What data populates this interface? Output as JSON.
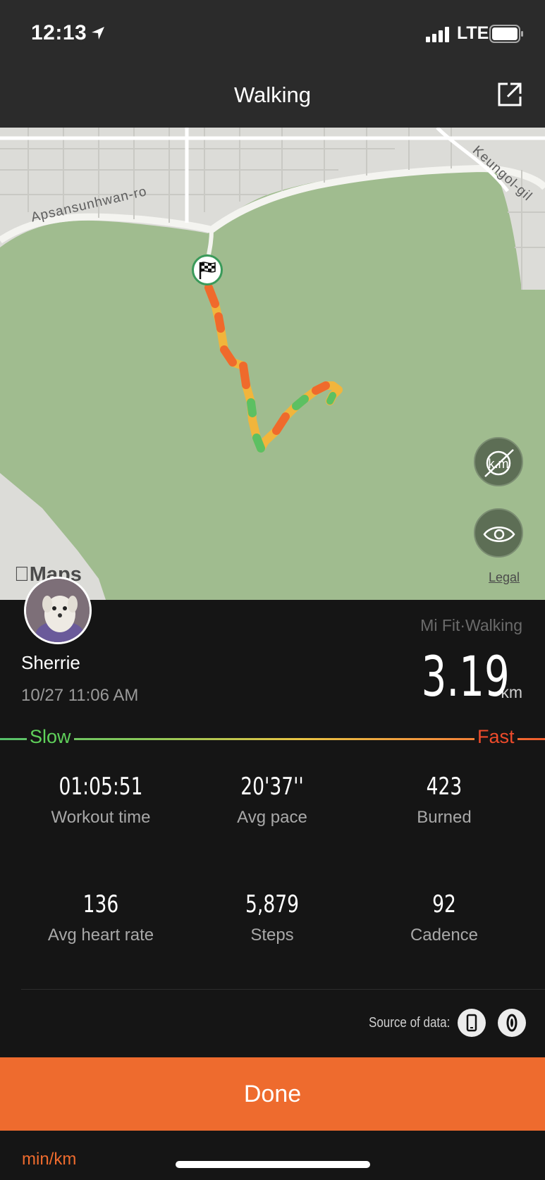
{
  "status_bar": {
    "time": "12:13",
    "network": "LTE",
    "location_icon": "location-arrow-icon",
    "signal_icon": "signal-bars-icon",
    "battery_icon": "battery-icon"
  },
  "nav": {
    "title": "Walking",
    "share_icon": "share-external-icon"
  },
  "map": {
    "streets": [
      "Apsansunhwan-ro",
      "Keungol-gil"
    ],
    "brand": "Maps",
    "legal": "Legal",
    "controls": [
      "km-markers-toggle-icon",
      "eye-icon"
    ],
    "start_marker_icon": "checkered-flag-icon"
  },
  "workout": {
    "user_name": "Sherrie",
    "date": "10/27 11:06 AM",
    "source": "Mi Fit·Walking",
    "distance": "3.19",
    "distance_unit": "km"
  },
  "pace_legend": {
    "slow": "Slow",
    "fast": "Fast",
    "colors": [
      "#55c06a",
      "#e8c444",
      "#ef5b2c"
    ]
  },
  "stats": [
    {
      "value": "01:05:51",
      "label": "Workout time"
    },
    {
      "value": "20'37''",
      "label": "Avg pace"
    },
    {
      "value": "423",
      "label": "Burned"
    },
    {
      "value": "136",
      "label": "Avg heart rate"
    },
    {
      "value": "5,879",
      "label": "Steps"
    },
    {
      "value": "92",
      "label": "Cadence"
    }
  ],
  "data_source": {
    "label": "Source of data:",
    "icons": [
      "phone-icon",
      "band-icon"
    ]
  },
  "actions": {
    "done": "Done"
  },
  "footer": {
    "units": "min/km"
  },
  "colors": {
    "accent": "#ee6b2e",
    "background": "#151515",
    "header": "#2b2b2b",
    "park": "#a0bc8f"
  }
}
